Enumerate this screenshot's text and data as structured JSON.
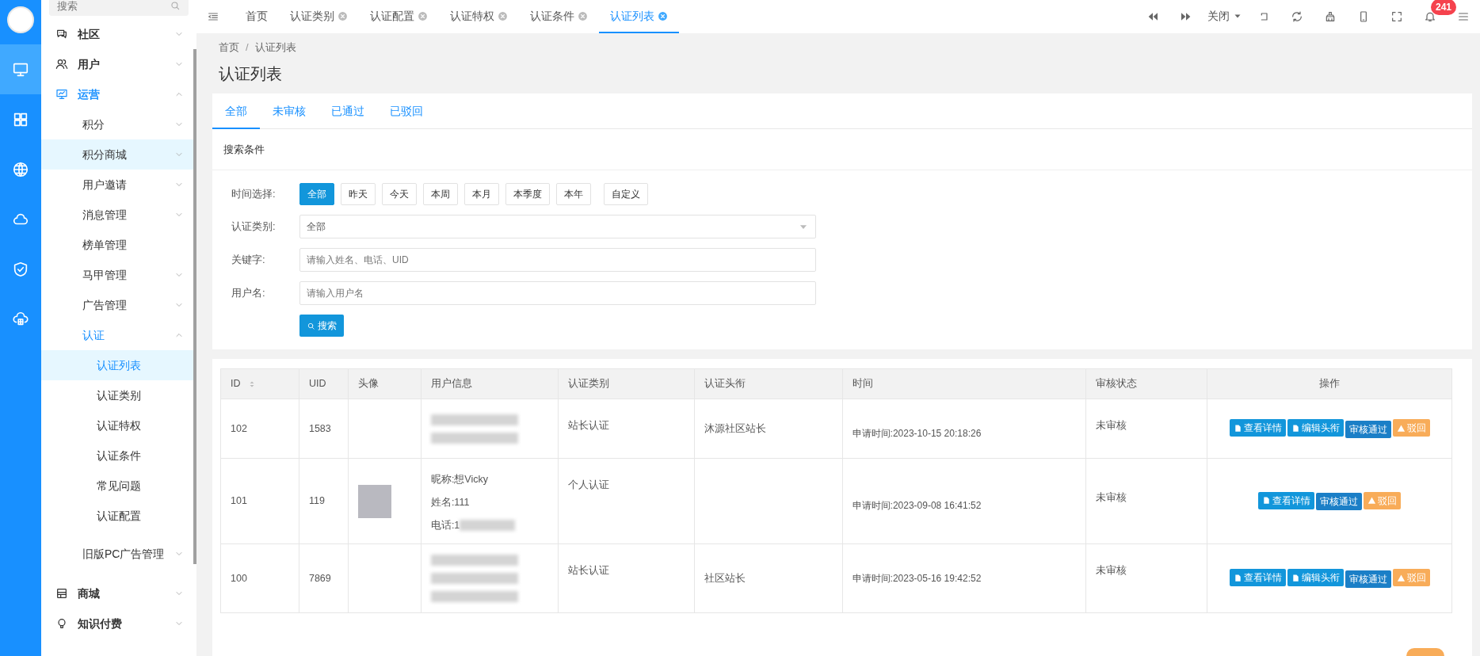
{
  "rail": {
    "items": [
      {
        "selected": true
      },
      {
        "selected": false
      },
      {
        "selected": false
      },
      {
        "selected": false
      },
      {
        "selected": false
      },
      {
        "selected": false
      }
    ]
  },
  "sidebar": {
    "search": {
      "placeholder": "搜索"
    },
    "items": [
      {
        "label": "社区",
        "kind": "folder",
        "expanded": false,
        "selected": false,
        "highlighted": false
      },
      {
        "label": "用户",
        "kind": "folder",
        "expanded": false,
        "selected": false,
        "highlighted": false
      },
      {
        "label": "运营",
        "kind": "folder",
        "expanded": true,
        "selected": false,
        "highlighted": false,
        "children": [
          {
            "label": "积分",
            "kind": "folder",
            "expanded": false,
            "selected": false,
            "highlighted": false
          },
          {
            "label": "积分商城",
            "kind": "folder",
            "expanded": false,
            "selected": false,
            "highlighted": true
          },
          {
            "label": "用户邀请",
            "kind": "folder",
            "expanded": false,
            "selected": false,
            "highlighted": false
          },
          {
            "label": "消息管理",
            "kind": "folder",
            "expanded": false,
            "selected": false,
            "highlighted": false
          },
          {
            "label": "榜单管理",
            "kind": "page",
            "selected": false,
            "highlighted": false
          },
          {
            "label": "马甲管理",
            "kind": "folder",
            "expanded": false,
            "selected": false,
            "highlighted": false
          },
          {
            "label": "广告管理",
            "kind": "folder",
            "expanded": false,
            "selected": false,
            "highlighted": false
          },
          {
            "label": "认证",
            "kind": "folder",
            "expanded": true,
            "selected": false,
            "highlighted": false,
            "children": [
              {
                "label": "认证列表",
                "kind": "page",
                "selected": true,
                "highlighted": false
              },
              {
                "label": "认证类别",
                "kind": "page",
                "selected": false,
                "highlighted": false
              },
              {
                "label": "认证特权",
                "kind": "page",
                "selected": false,
                "highlighted": false
              },
              {
                "label": "认证条件",
                "kind": "page",
                "selected": false,
                "highlighted": false
              },
              {
                "label": "常见问题",
                "kind": "page",
                "selected": false,
                "highlighted": false
              },
              {
                "label": "认证配置",
                "kind": "page",
                "selected": false,
                "highlighted": false
              }
            ]
          },
          {
            "label": "旧版PC广告管理",
            "kind": "folder",
            "expanded": false,
            "selected": false,
            "highlighted": false
          }
        ]
      },
      {
        "label": "商城",
        "kind": "folder",
        "expanded": false,
        "selected": false,
        "highlighted": false
      },
      {
        "label": "知识付费",
        "kind": "folder",
        "expanded": false,
        "selected": false,
        "highlighted": false
      }
    ]
  },
  "page_tabs": [
    {
      "label": "首页",
      "closable": false,
      "selected": false
    },
    {
      "label": "认证类别",
      "closable": true,
      "selected": false
    },
    {
      "label": "认证配置",
      "closable": true,
      "selected": false
    },
    {
      "label": "认证特权",
      "closable": true,
      "selected": false
    },
    {
      "label": "认证条件",
      "closable": true,
      "selected": false
    },
    {
      "label": "认证列表",
      "closable": true,
      "selected": true
    }
  ],
  "toolbar": {
    "close_menu": "关闭",
    "notification_count": "241"
  },
  "breadcrumb": {
    "items": [
      "首页",
      "认证列表"
    ],
    "separator": "/"
  },
  "page_title": "认证列表",
  "status_tabs": [
    {
      "label": "全部",
      "selected": true
    },
    {
      "label": "未审核",
      "selected": false
    },
    {
      "label": "已通过",
      "selected": false
    },
    {
      "label": "已驳回",
      "selected": false
    }
  ],
  "filter": {
    "title": "搜索条件",
    "time_label": "时间选择:",
    "time_options": [
      {
        "label": "全部",
        "selected": true
      },
      {
        "label": "昨天",
        "selected": false
      },
      {
        "label": "今天",
        "selected": false
      },
      {
        "label": "本周",
        "selected": false
      },
      {
        "label": "本月",
        "selected": false
      },
      {
        "label": "本季度",
        "selected": false
      },
      {
        "label": "本年",
        "selected": false
      },
      {
        "label": "自定义",
        "selected": false
      }
    ],
    "category_label": "认证类别:",
    "category_value": "全部",
    "keyword_label": "关键字:",
    "keyword_placeholder": "请输入姓名、电话、UID",
    "username_label": "用户名:",
    "username_placeholder": "请输入用户名",
    "search_button": "搜索"
  },
  "table": {
    "columns": [
      "ID",
      "UID",
      "头像",
      "用户信息",
      "认证类别",
      "认证头衔",
      "时间",
      "审核状态",
      "操作"
    ],
    "rows": [
      {
        "id": "102",
        "uid": "1583",
        "photo": false,
        "info": [
          {
            "kind": "blurred"
          },
          {
            "kind": "blurred"
          }
        ],
        "category": "站长认证",
        "title": "沐源社区站长",
        "time": "申请时间:2023-10-15 20:18:26",
        "status": "未审核",
        "actions": [
          {
            "label": "查看详情",
            "kind": "view"
          },
          {
            "label": "编辑头衔",
            "kind": "edit"
          },
          {
            "label": "审核通过",
            "kind": "approve"
          },
          {
            "label": "驳回",
            "kind": "reject"
          }
        ]
      },
      {
        "id": "101",
        "uid": "119",
        "photo": true,
        "info": [
          {
            "kind": "text",
            "text": "昵称:想Vicky"
          },
          {
            "kind": "text",
            "text": "姓名:111"
          },
          {
            "kind": "partial",
            "text": "电话:1"
          }
        ],
        "category": "个人认证",
        "title": "",
        "time": "申请时间:2023-09-08 16:41:52",
        "status": "未审核",
        "actions": [
          {
            "label": "查看详情",
            "kind": "view"
          },
          {
            "label": "审核通过",
            "kind": "approve"
          },
          {
            "label": "驳回",
            "kind": "reject"
          }
        ]
      },
      {
        "id": "100",
        "uid": "7869",
        "photo": false,
        "info": [
          {
            "kind": "blurred"
          },
          {
            "kind": "blurred"
          },
          {
            "kind": "blurred"
          }
        ],
        "category": "站长认证",
        "title": "社区站长",
        "time": "申请时间:2023-05-16 19:42:52",
        "status": "未审核",
        "actions": [
          {
            "label": "查看详情",
            "kind": "view"
          },
          {
            "label": "编辑头衔",
            "kind": "edit"
          },
          {
            "label": "审核通过",
            "kind": "approve"
          },
          {
            "label": "驳回",
            "kind": "reject"
          }
        ]
      }
    ]
  }
}
